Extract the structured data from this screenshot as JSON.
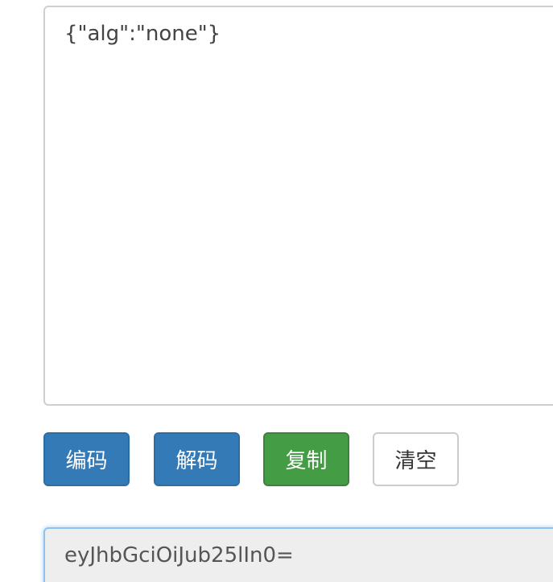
{
  "input": {
    "value": "{\"alg\":\"none\"}"
  },
  "buttons": {
    "encode": "编码",
    "decode": "解码",
    "copy": "复制",
    "clear": "清空"
  },
  "output": {
    "value": "eyJhbGciOiJub25lIn0="
  },
  "colors": {
    "primary": "#337ab7",
    "success": "#449d44",
    "default_border": "#cccccc",
    "focus_border": "#8dc3ee",
    "output_bg": "#eeeeee"
  }
}
